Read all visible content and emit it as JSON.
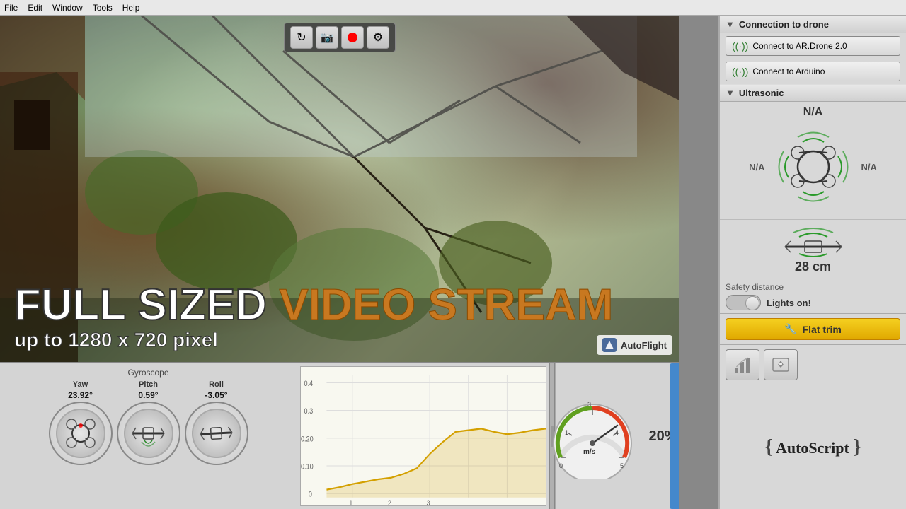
{
  "app": {
    "title": "AutoFlight"
  },
  "menubar": {
    "items": [
      "File",
      "Edit",
      "Window",
      "Tools",
      "Help"
    ]
  },
  "video": {
    "toolbar": {
      "refresh_label": "↻",
      "camera_label": "📷",
      "record_label": "●",
      "settings_label": "⚙"
    },
    "watermark": "AutoFlight",
    "fullsize_banner_line1_part1": "FULL SIZED",
    "fullsize_banner_line1_part2": "VIDEO STREAM",
    "fullsize_banner_line2": "up to 1280 x 720 pixel"
  },
  "gyroscope": {
    "title": "Gyroscope",
    "yaw_label": "Yaw",
    "pitch_label": "Pitch",
    "roll_label": "Roll",
    "yaw_value": "23.92°",
    "pitch_value": "0.59°",
    "roll_value": "-3.05°"
  },
  "right_panel": {
    "connection": {
      "header": "Connection to drone",
      "btn1": "Connect to AR.Drone 2.0",
      "btn2": "Connect to Arduino"
    },
    "ultrasonic": {
      "header": "Ultrasonic",
      "top_value": "N/A",
      "left_value": "N/A",
      "right_value": "N/A",
      "bottom_value": "28 cm"
    },
    "safety": {
      "title": "Safety distance",
      "lights_label": "Lights on!"
    },
    "flat_trim": {
      "label": "Flat trim"
    },
    "autoscript": {
      "label": "AutoScript"
    }
  },
  "speed": {
    "percent": "20%",
    "unit": "m/s"
  },
  "chart": {
    "y_labels": [
      "0.4",
      "0.3",
      "0.20",
      "0.10",
      "0"
    ]
  }
}
